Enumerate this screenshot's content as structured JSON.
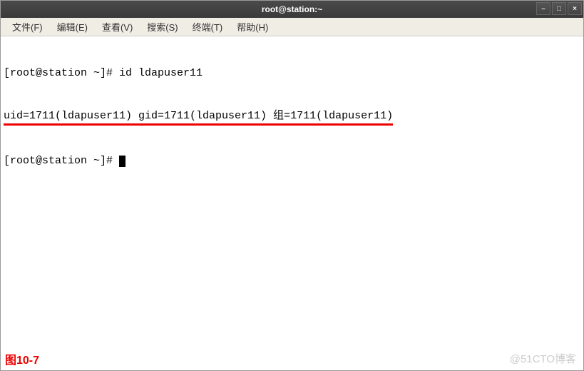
{
  "window": {
    "title": "root@station:~"
  },
  "controls": {
    "min": "–",
    "max": "□",
    "close": "×"
  },
  "menu": {
    "file": "文件(F)",
    "edit": "编辑(E)",
    "view": "查看(V)",
    "search": "搜索(S)",
    "terminal": "终端(T)",
    "help": "帮助(H)"
  },
  "terminal": {
    "line1": "[root@station ~]# id ldapuser11",
    "line2": "uid=1711(ldapuser11) gid=1711(ldapuser11) 组=1711(ldapuser11)",
    "line3_prompt": "[root@station ~]# "
  },
  "figure_label": "图10-7",
  "watermark": "@51CTO博客"
}
